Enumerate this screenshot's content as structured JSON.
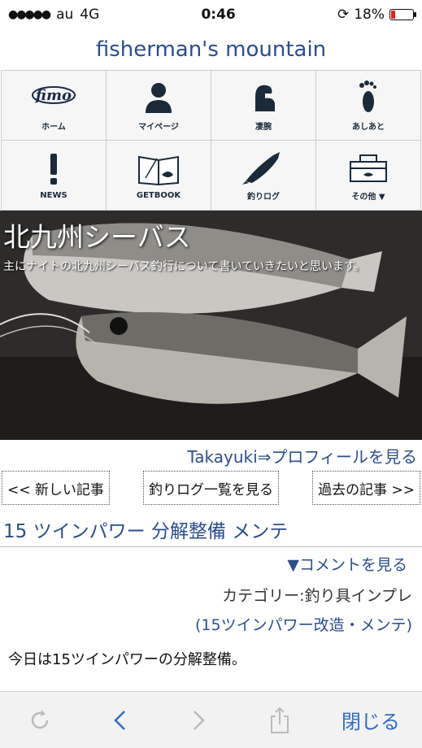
{
  "status": {
    "carrier": "au",
    "network": "4G",
    "time": "0:46",
    "battery": "18%"
  },
  "site_title": "fisherman's mountain",
  "menu": [
    {
      "label": "ホーム",
      "icon": "fimo-logo-icon"
    },
    {
      "label": "マイページ",
      "icon": "person-icon"
    },
    {
      "label": "凄腕",
      "icon": "arm-icon"
    },
    {
      "label": "あしあと",
      "icon": "footprint-icon"
    },
    {
      "label": "NEWS",
      "icon": "exclamation-icon"
    },
    {
      "label": "GETBOOK",
      "icon": "book-icon"
    },
    {
      "label": "釣りログ",
      "icon": "fish-icon"
    },
    {
      "label": "その他 ▼",
      "icon": "tackle-box-icon"
    }
  ],
  "hero": {
    "title": "北九州シーバス",
    "subtitle": "主にナイトの北九州シーバス釣行について書いていきたいと思います。"
  },
  "profile_link": "Takayuki⇒プロフィールを見る",
  "nav": {
    "newer": "<< 新しい記事",
    "list": "釣りログ一覧を見る",
    "older": "過去の記事 >>"
  },
  "post": {
    "title": "15 ツインパワー 分解整備 メンテ",
    "comment_link": "▼コメントを見る",
    "category": "カテゴリー:釣り具インプレ",
    "tag": "(15ツインパワー改造・メンテ)",
    "body": "今日は15ツインパワーの分解整備。"
  },
  "toolbar": {
    "close": "閉じる"
  },
  "colors": {
    "link": "#2b4e8c",
    "toolbar_accent": "#2b6cc4",
    "battery_low": "#e2231a"
  }
}
